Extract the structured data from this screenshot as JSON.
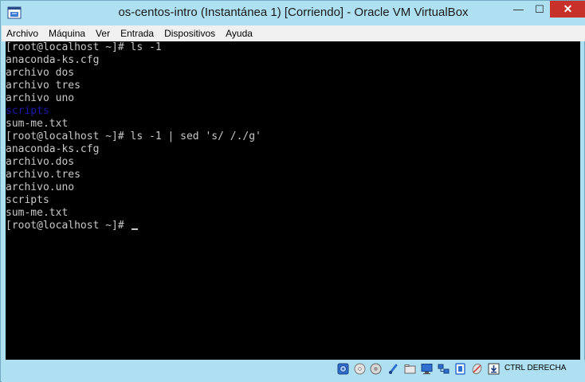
{
  "window": {
    "title": "os-centos-intro (Instantánea 1) [Corriendo] - Oracle VM VirtualBox",
    "min_label": "—",
    "max_label": "☐",
    "close_label": "✕"
  },
  "menu": {
    "items": [
      "Archivo",
      "Máquina",
      "Ver",
      "Entrada",
      "Dispositivos",
      "Ayuda"
    ]
  },
  "terminal": {
    "lines": [
      {
        "text": "[root@localhost ~]# ls -1",
        "kind": "prompt"
      },
      {
        "text": "anaconda-ks.cfg",
        "kind": "output"
      },
      {
        "text": "archivo dos",
        "kind": "output"
      },
      {
        "text": "archivo tres",
        "kind": "output"
      },
      {
        "text": "archivo uno",
        "kind": "output"
      },
      {
        "text": "scripts",
        "kind": "directory"
      },
      {
        "text": "sum-me.txt",
        "kind": "output"
      },
      {
        "text": "[root@localhost ~]# ls -1 | sed 's/ /./g'",
        "kind": "prompt"
      },
      {
        "text": "anaconda-ks.cfg",
        "kind": "output"
      },
      {
        "text": "archivo.dos",
        "kind": "output"
      },
      {
        "text": "archivo.tres",
        "kind": "output"
      },
      {
        "text": "archivo.uno",
        "kind": "output"
      },
      {
        "text": "scripts",
        "kind": "output"
      },
      {
        "text": "sum-me.txt",
        "kind": "output"
      },
      {
        "text": "[root@localhost ~]# ",
        "kind": "prompt",
        "cursor": true
      }
    ],
    "colors": {
      "background": "#000000",
      "text": "#c8c8c8",
      "directory": "#1a1ab0"
    }
  },
  "statusbar": {
    "icons": [
      "hard-disk-icon",
      "optical-drive-icon",
      "floppy-disk-icon",
      "usb-icon",
      "shared-folder-icon",
      "display-icon",
      "network-icon",
      "video-capture-icon",
      "mouse-integration-icon",
      "host-key-arrow-icon"
    ],
    "host_key_label": "CTRL DERECHA"
  },
  "colors": {
    "frame": "#aee0f1",
    "close_button": "#c7312a",
    "menubar": "#f0f0f0"
  }
}
